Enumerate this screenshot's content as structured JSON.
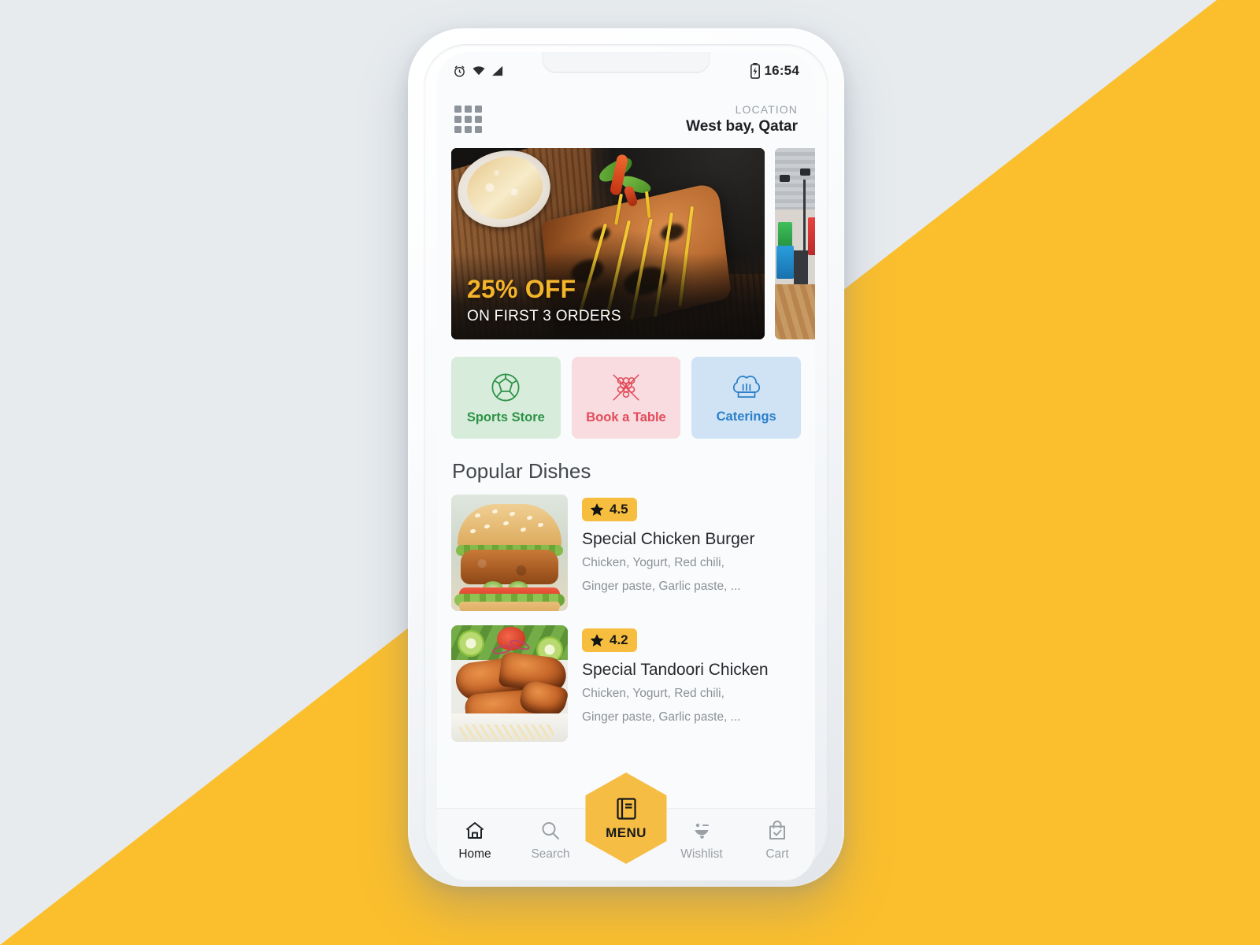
{
  "background": {
    "base_color": "#e7ebee",
    "accent_color": "#fbbf2d"
  },
  "phone": {
    "statusbar": {
      "time": "16:54",
      "icons_left": [
        "alarm-icon",
        "wifi-icon",
        "signal-icon"
      ],
      "icons_right": [
        "battery-charging-icon"
      ]
    },
    "header": {
      "grid_icon": "grid-menu-icon",
      "location_label": "LOCATION",
      "location_value": "West bay, Qatar"
    },
    "banner": {
      "headline": "25% OFF",
      "subline": "ON FIRST 3 ORDERS",
      "headline_color": "#f4b52b"
    },
    "categories": [
      {
        "label": "Sports Store",
        "icon": "soccer-ball-icon",
        "bg": "#d7ecdb",
        "color": "#2d9246"
      },
      {
        "label": "Book a Table",
        "icon": "billiards-rack-icon",
        "bg": "#f8dcdf",
        "color": "#e24b5a"
      },
      {
        "label": "Caterings",
        "icon": "chef-hat-icon",
        "bg": "#cfe3f5",
        "color": "#2b7fc9"
      }
    ],
    "popular": {
      "title": "Popular Dishes",
      "dishes": [
        {
          "rating": "4.5",
          "name": "Special Chicken Burger",
          "desc_line1": "Chicken, Yogurt, Red chili,",
          "desc_line2": "Ginger paste, Garlic paste, ..."
        },
        {
          "rating": "4.2",
          "name": "Special Tandoori Chicken",
          "desc_line1": "Chicken, Yogurt, Red chili,",
          "desc_line2": "Ginger paste, Garlic paste, ..."
        }
      ]
    },
    "bottom_nav": {
      "items": [
        {
          "label": "Home",
          "icon": "home-icon",
          "active": true
        },
        {
          "label": "Search",
          "icon": "search-icon",
          "active": false
        },
        {
          "label": "Wishlist",
          "icon": "winking-face-icon",
          "active": false
        },
        {
          "label": "Cart",
          "icon": "shopping-bag-check-icon",
          "active": false
        }
      ],
      "fab": {
        "label": "MENU",
        "icon": "book-icon",
        "color": "#f6bd44"
      }
    }
  }
}
